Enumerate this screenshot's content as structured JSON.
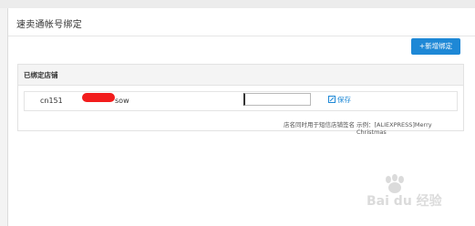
{
  "page": {
    "title": "速卖通帐号绑定"
  },
  "toolbar": {
    "add_label": "+新增绑定"
  },
  "bound_shops": {
    "section_title": "已绑定店铺",
    "rows": [
      {
        "account_prefix": "cn151",
        "account_suffix": "sow",
        "signature_value": "",
        "save_label": "保存"
      }
    ]
  },
  "hints": {
    "usage": "店名同时用于短信店铺签名",
    "example": "示例：[ALIEXPRESS]Merry Christmas"
  },
  "watermark": {
    "text": "Bai du 经验"
  },
  "colors": {
    "accent": "#1e88d6",
    "redaction": "#f21d1d"
  },
  "icons": {
    "save": "edit-icon"
  }
}
